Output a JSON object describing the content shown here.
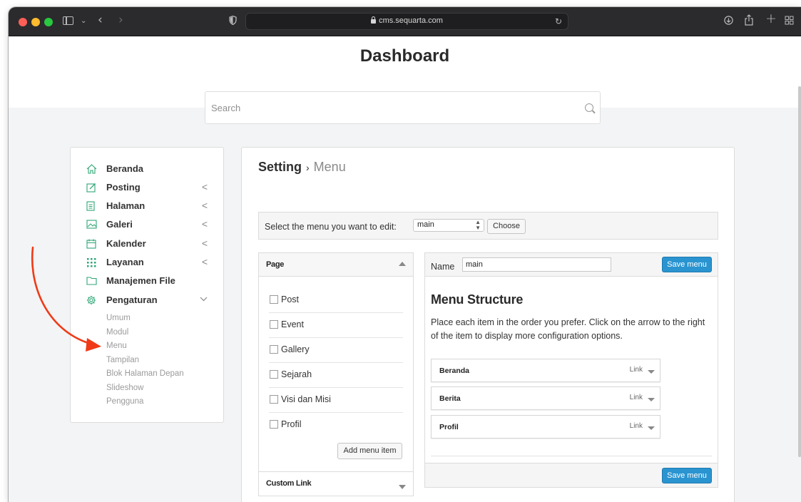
{
  "browser": {
    "url": "cms.sequarta.com"
  },
  "page": {
    "title": "Dashboard",
    "search_placeholder": "Search"
  },
  "sidebar": {
    "items": [
      {
        "label": "Beranda",
        "icon": "home-icon"
      },
      {
        "label": "Posting",
        "icon": "edit-icon",
        "chevron": "<"
      },
      {
        "label": "Halaman",
        "icon": "document-icon",
        "chevron": "<"
      },
      {
        "label": "Galeri",
        "icon": "image-icon",
        "chevron": "<"
      },
      {
        "label": "Kalender",
        "icon": "calendar-icon",
        "chevron": "<"
      },
      {
        "label": "Layanan",
        "icon": "grid-icon",
        "chevron": "<"
      },
      {
        "label": "Manajemen File",
        "icon": "folder-icon"
      },
      {
        "label": "Pengaturan",
        "icon": "gear-icon",
        "chevron": "v"
      }
    ],
    "subitems": [
      "Umum",
      "Modul",
      "Menu",
      "Tampilan",
      "Blok Halaman Depan",
      "Slideshow",
      "Pengguna"
    ]
  },
  "breadcrumb": {
    "section": "Setting",
    "separator": "›",
    "current": "Menu"
  },
  "menu_select": {
    "label": "Select the menu you want to edit:",
    "selected": "main",
    "choose_label": "Choose"
  },
  "page_panel": {
    "title": "Page",
    "items": [
      "Post",
      "Event",
      "Gallery",
      "Sejarah",
      "Visi dan Misi",
      "Profil"
    ],
    "add_button": "Add menu item",
    "custom_link_title": "Custom Link"
  },
  "structure": {
    "name_label": "Name",
    "name_value": "main",
    "save_label": "Save menu",
    "title": "Menu Structure",
    "description": "Place each item in the order you prefer. Click on the arrow to the right of the item to display more configuration options.",
    "items": [
      {
        "title": "Beranda",
        "type": "Link"
      },
      {
        "title": "Berita",
        "type": "Link"
      },
      {
        "title": "Profil",
        "type": "Link"
      }
    ]
  },
  "colors": {
    "accent_green": "#2ea776",
    "button_blue": "#2a94d0",
    "annotation_red": "#f03a17"
  }
}
